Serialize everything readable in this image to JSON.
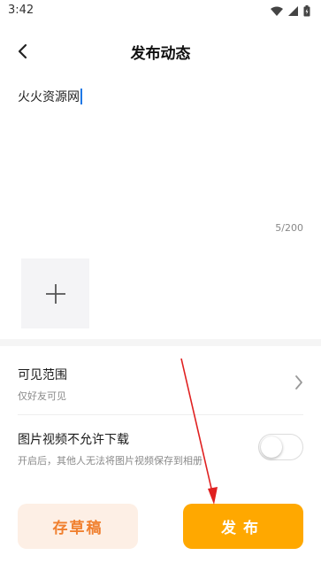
{
  "status_bar": {
    "time": "3:42"
  },
  "header": {
    "title": "发布动态"
  },
  "post": {
    "text": "火火资源网",
    "char_count": "5/200"
  },
  "settings": {
    "visibility": {
      "title": "可见范围",
      "value": "仅好友可见"
    },
    "no_download": {
      "title": "图片视频不允许下载",
      "description": "开启后，其他人无法将图片视频保存到相册",
      "enabled": false
    }
  },
  "actions": {
    "draft_label": "存草稿",
    "publish_label": "发布"
  },
  "colors": {
    "accent": "#ffa800",
    "draft_bg": "#fdefe5",
    "draft_text": "#f07f2e",
    "annotation_arrow": "#e02020"
  },
  "icons": {
    "back": "back-arrow-icon",
    "add": "plus-icon",
    "chevron": "chevron-right-icon"
  }
}
